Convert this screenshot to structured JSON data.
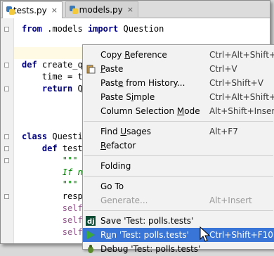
{
  "tabs": [
    {
      "label": "tests.py",
      "close": "×",
      "active": true
    },
    {
      "label": "models.py",
      "close": "×",
      "active": false
    }
  ],
  "code_lines": [
    {
      "parts": [
        {
          "t": "from",
          "c": "kw"
        },
        {
          "t": " .models ",
          "c": "plain"
        },
        {
          "t": "import",
          "c": "kw"
        },
        {
          "t": " Question",
          "c": "plain"
        }
      ]
    },
    {
      "parts": []
    },
    {
      "parts": [
        {
          "t": "def",
          "c": "kw"
        },
        {
          "t": " create_q",
          "c": "plain"
        }
      ]
    },
    {
      "parts": [
        {
          "t": "    time = t",
          "c": "plain"
        }
      ]
    },
    {
      "parts": [
        {
          "t": "    ",
          "c": "plain"
        },
        {
          "t": "return",
          "c": "kw"
        },
        {
          "t": " Qu",
          "c": "plain"
        }
      ]
    },
    {
      "parts": []
    },
    {
      "parts": []
    },
    {
      "parts": [
        {
          "t": "class",
          "c": "kw"
        },
        {
          "t": " Questio",
          "c": "plain"
        }
      ]
    },
    {
      "parts": [
        {
          "t": "    ",
          "c": "plain"
        },
        {
          "t": "def",
          "c": "kw"
        },
        {
          "t": " test_",
          "c": "plain"
        }
      ]
    },
    {
      "parts": [
        {
          "t": "        \"\"\"",
          "c": "doc"
        }
      ]
    },
    {
      "parts": [
        {
          "t": "        If no",
          "c": "doc"
        }
      ]
    },
    {
      "parts": [
        {
          "t": "        \"\"\"",
          "c": "doc"
        }
      ]
    },
    {
      "parts": [
        {
          "t": "        respo",
          "c": "plain"
        }
      ]
    },
    {
      "parts": [
        {
          "t": "        ",
          "c": "plain"
        },
        {
          "t": "self.",
          "c": "self"
        }
      ]
    },
    {
      "parts": [
        {
          "t": "        ",
          "c": "plain"
        },
        {
          "t": "self.",
          "c": "self"
        }
      ]
    },
    {
      "parts": [
        {
          "t": "        ",
          "c": "plain"
        },
        {
          "t": "self.",
          "c": "self"
        }
      ]
    }
  ],
  "menu": {
    "items": [
      {
        "label": "Copy Reference",
        "u": 5,
        "shortcut": "Ctrl+Alt+Shift+C",
        "icon": "",
        "state": "normal",
        "name": "copy-reference"
      },
      {
        "label": "Paste",
        "u": 0,
        "shortcut": "Ctrl+V",
        "icon": "paste-icon",
        "state": "normal",
        "name": "paste"
      },
      {
        "label": "Paste from History...",
        "u": 4,
        "shortcut": "Ctrl+Shift+V",
        "icon": "",
        "state": "normal",
        "name": "paste-from-history"
      },
      {
        "label": "Paste Simple",
        "u": 7,
        "shortcut": "Ctrl+Alt+Shift+V",
        "icon": "",
        "state": "normal",
        "name": "paste-simple"
      },
      {
        "label": "Column Selection Mode",
        "u": 17,
        "shortcut": "Alt+Shift+Insert",
        "icon": "",
        "state": "normal",
        "name": "column-selection-mode"
      },
      {
        "sep": true
      },
      {
        "label": "Find Usages",
        "u": 5,
        "shortcut": "Alt+F7",
        "icon": "",
        "state": "normal",
        "name": "find-usages"
      },
      {
        "label": "Refactor",
        "u": 0,
        "shortcut": "",
        "icon": "",
        "state": "normal",
        "name": "refactor"
      },
      {
        "sep": true
      },
      {
        "label": "Folding",
        "u": -1,
        "shortcut": "",
        "icon": "",
        "state": "normal",
        "name": "folding"
      },
      {
        "sep": true
      },
      {
        "label": "Go To",
        "u": -1,
        "shortcut": "",
        "icon": "",
        "state": "normal",
        "name": "go-to"
      },
      {
        "label": "Generate...",
        "u": -1,
        "shortcut": "Alt+Insert",
        "icon": "",
        "state": "disabled",
        "name": "generate"
      },
      {
        "sep": true
      },
      {
        "label": "Save 'Test: polls.tests'",
        "u": -1,
        "shortcut": "",
        "icon": "django-icon",
        "state": "normal",
        "name": "save-test"
      },
      {
        "label": "Run 'Test: polls.tests'",
        "u": 1,
        "shortcut": "Ctrl+Shift+F10",
        "icon": "run-icon",
        "state": "selected",
        "name": "run-test"
      },
      {
        "label": "Debug 'Test: polls.tests'",
        "u": -1,
        "shortcut": "",
        "icon": "debug-icon",
        "state": "normal",
        "name": "debug-test"
      }
    ]
  },
  "colors": {
    "selection": "#3875d7",
    "caret_line": "#fffae3",
    "keyword": "#000080",
    "docstring": "#008000",
    "self": "#94558d"
  }
}
